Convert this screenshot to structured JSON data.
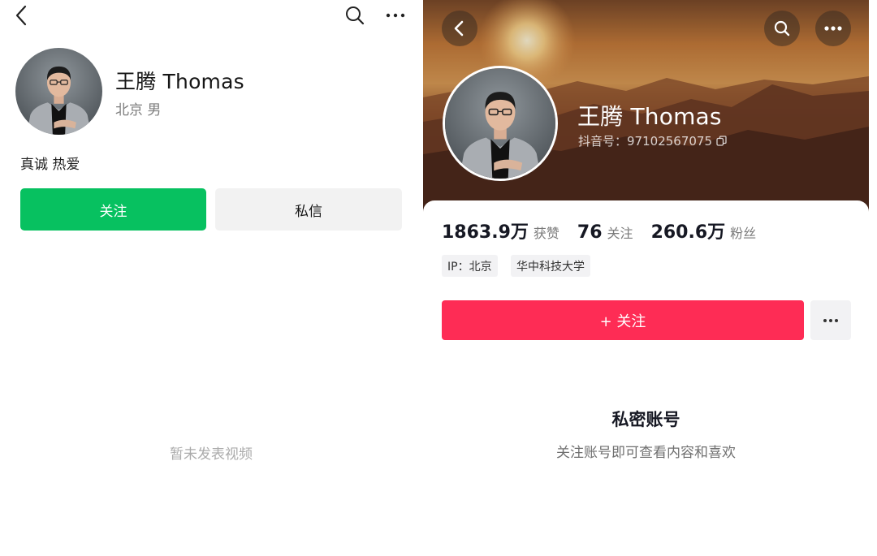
{
  "left_panel": {
    "header": {
      "back_icon": "chevron-left-icon",
      "search_icon": "search-icon",
      "more_icon": "more-horizontal-icon"
    },
    "profile": {
      "name": "王腾 Thomas",
      "meta": "北京 男",
      "bio": "真诚 热爱"
    },
    "buttons": {
      "follow_label": "关注",
      "message_label": "私信"
    },
    "empty_text": "暂未发表视频",
    "colors": {
      "follow_bg": "#07c160",
      "message_bg": "#f2f2f2"
    }
  },
  "right_panel": {
    "header": {
      "back_icon": "chevron-left-icon",
      "search_icon": "search-icon",
      "more_icon": "more-horizontal-icon"
    },
    "profile": {
      "name": "王腾 Thomas",
      "id_label": "抖音号：",
      "id_value": "97102567075",
      "copy_icon": "copy-icon"
    },
    "stats": [
      {
        "value": "1863.9万",
        "label": "获赞"
      },
      {
        "value": "76",
        "label": "关注"
      },
      {
        "value": "260.6万",
        "label": "粉丝"
      }
    ],
    "tags": [
      "IP：北京",
      "华中科技大学"
    ],
    "follow_button": {
      "label": "+ 关注",
      "more_icon": "more-horizontal-icon"
    },
    "private_notice": {
      "title": "私密账号",
      "subtitle": "关注账号即可查看内容和喜欢"
    },
    "colors": {
      "follow_bg": "#fe2c55",
      "header_sunset": "#b8642a"
    }
  }
}
